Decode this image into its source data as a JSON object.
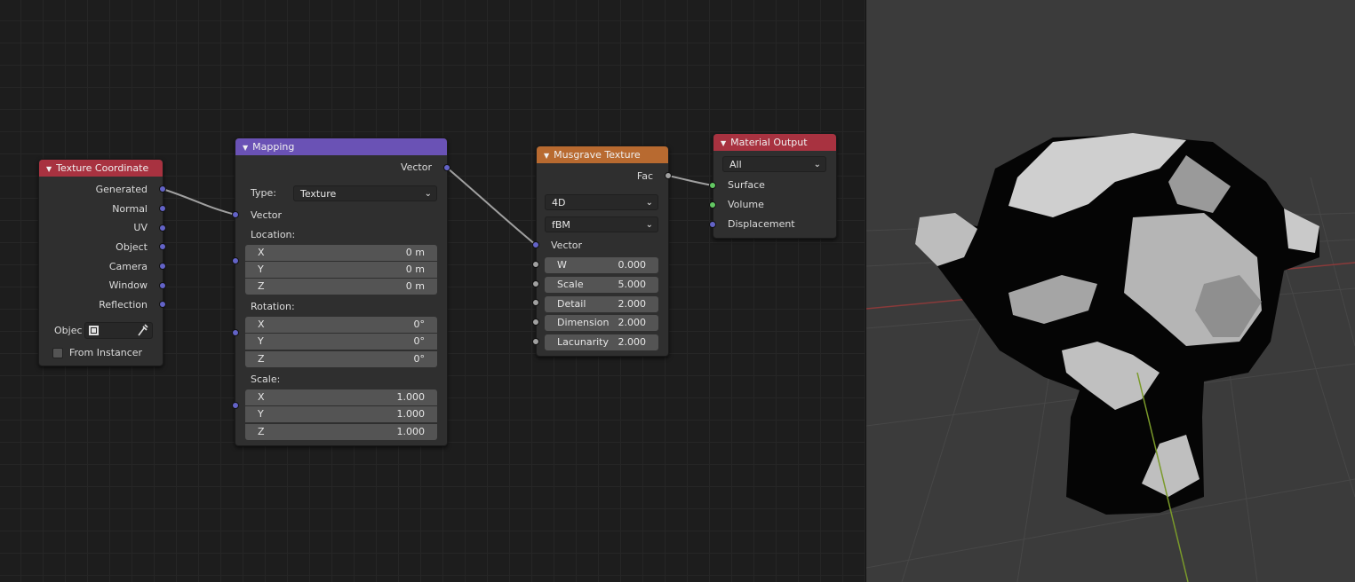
{
  "nodes": {
    "texcoord": {
      "title": "Texture Coordinate",
      "header_color": "#a83240",
      "outputs": [
        "Generated",
        "Normal",
        "UV",
        "Object",
        "Camera",
        "Window",
        "Reflection"
      ],
      "object_label": "Objec",
      "from_instancer_label": "From Instancer",
      "from_instancer_checked": false
    },
    "mapping": {
      "title": "Mapping",
      "header_color": "#6a52b5",
      "output_label": "Vector",
      "type_label": "Type:",
      "type_value": "Texture",
      "input_vector": "Vector",
      "location_label": "Location:",
      "location": [
        {
          "axis": "X",
          "value": "0 m"
        },
        {
          "axis": "Y",
          "value": "0 m"
        },
        {
          "axis": "Z",
          "value": "0 m"
        }
      ],
      "rotation_label": "Rotation:",
      "rotation": [
        {
          "axis": "X",
          "value": "0°"
        },
        {
          "axis": "Y",
          "value": "0°"
        },
        {
          "axis": "Z",
          "value": "0°"
        }
      ],
      "scale_label": "Scale:",
      "scale": [
        {
          "axis": "X",
          "value": "1.000"
        },
        {
          "axis": "Y",
          "value": "1.000"
        },
        {
          "axis": "Z",
          "value": "1.000"
        }
      ]
    },
    "musgrave": {
      "title": "Musgrave Texture",
      "header_color": "#b86a30",
      "output_label": "Fac",
      "dimensions_value": "4D",
      "type_value": "fBM",
      "input_vector": "Vector",
      "params": [
        {
          "label": "W",
          "value": "0.000"
        },
        {
          "label": "Scale",
          "value": "5.000"
        },
        {
          "label": "Detail",
          "value": "2.000"
        },
        {
          "label": "Dimension",
          "value": "2.000"
        },
        {
          "label": "Lacunarity",
          "value": "2.000"
        }
      ]
    },
    "output": {
      "title": "Material Output",
      "header_color": "#a83240",
      "target_value": "All",
      "inputs": [
        "Surface",
        "Volume",
        "Displacement"
      ]
    }
  },
  "icons": {
    "collapse": "triangle-down-icon",
    "dropdown": "chevron-down-icon",
    "object": "object-box-icon",
    "eyedropper": "eyedropper-icon"
  },
  "colors": {
    "socket_vector": "#6363c7",
    "socket_float": "#a1a1a1",
    "socket_shader": "#63c763",
    "link": "#a0a0a0"
  }
}
